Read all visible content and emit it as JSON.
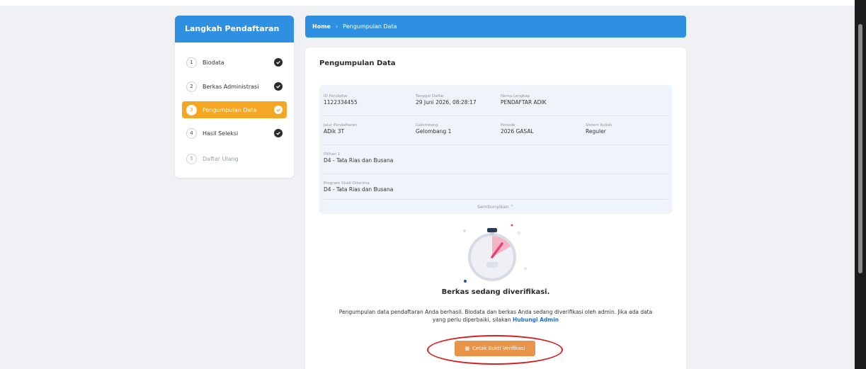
{
  "sidebar": {
    "title": "Langkah Pendaftaran",
    "steps": [
      {
        "num": "1",
        "label": "Biodata",
        "state": "done"
      },
      {
        "num": "2",
        "label": "Berkas Administrasi",
        "state": "done"
      },
      {
        "num": "3",
        "label": "Pengumpulan Data",
        "state": "active"
      },
      {
        "num": "4",
        "label": "Hasil Seleksi",
        "state": "done"
      },
      {
        "num": "5",
        "label": "Daftar Ulang",
        "state": "disabled"
      }
    ]
  },
  "breadcrumb": {
    "home": "Home",
    "separator": "›",
    "current": "Pengumpulan Data"
  },
  "card": {
    "title": "Pengumpulan Data",
    "info": {
      "id_label": "ID Pendaftar",
      "id_value": "1122334455",
      "date_label": "Tanggal Daftar",
      "date_value": "29 Juni 2026, 08:28:17",
      "name_label": "Nama Lengkap",
      "name_value": "PENDAFTAR ADIK",
      "path_label": "Jalur Pendaftaran",
      "path_value": "ADik 3T",
      "wave_label": "Gelombang",
      "wave_value": "Gelombang 1",
      "period_label": "Periode",
      "period_value": "2026 GASAL",
      "system_label": "Sistem Kuliah",
      "system_value": "Reguler",
      "choice_label": "Pilihan 1",
      "choice_value": "D4 - Tata Rias dan Busana",
      "accepted_label": "Program Studi Diterima",
      "accepted_value": "D4 - Tata Rias dan Busana",
      "toggle": "Sembunyikan ⌃"
    },
    "status_title": "Berkas sedang diverifikasi.",
    "status_desc_1": "Pengumpulan data pendaftaran Anda berhasil. Biodata dan berkas Anda sedang diverifikasi oleh admin. Jika ada data",
    "status_desc_2": "yang perlu diperbaiki, silakan ",
    "contact_link": "Hubungi Admin",
    "print_button": "Cetak Bukti Verifikasi"
  },
  "colors": {
    "primary": "#2f8fe0",
    "active_step": "#f5a623",
    "button": "#e89449",
    "highlight": "#d71f1f"
  },
  "icons": {
    "check": "check-circle-icon",
    "print": "printer-icon",
    "timer": "stopwatch-illustration"
  }
}
